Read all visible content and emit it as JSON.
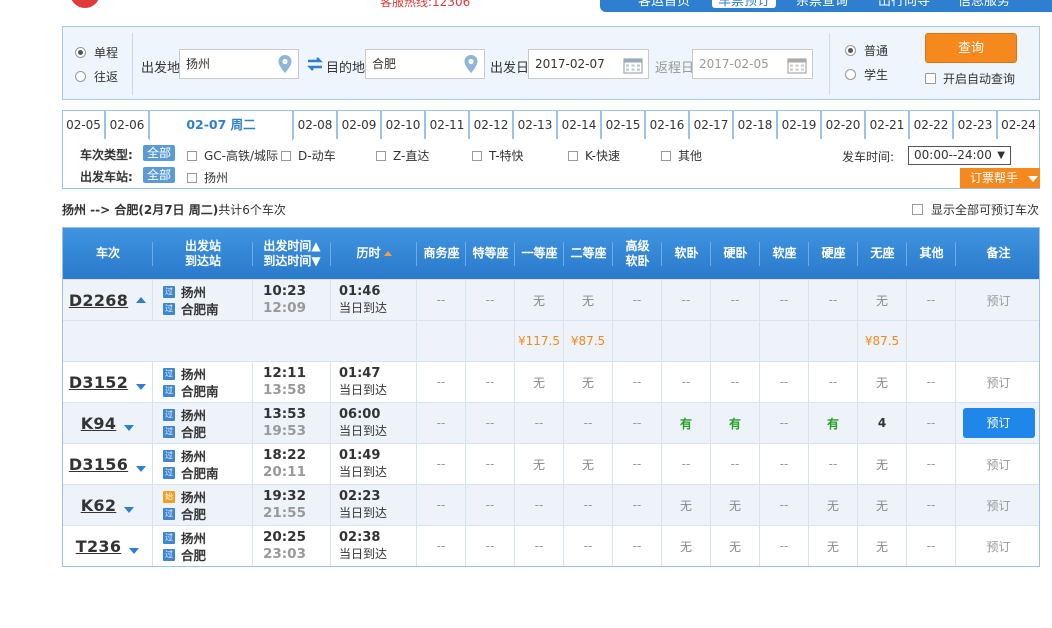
{
  "topbar": {
    "hotline": "客服热线:12306",
    "nav": [
      "客运首页",
      "车票预订",
      "余票查询",
      "出行向导",
      "信息服务"
    ],
    "active_nav": 1
  },
  "search": {
    "trip_types": [
      "单程",
      "往返"
    ],
    "trip_selected": 0,
    "from_label": "出发地",
    "from_value": "扬州",
    "to_label": "目的地",
    "to_value": "合肥",
    "depart_label": "出发日",
    "depart_value": "2017-02-07",
    "return_label": "返程日",
    "return_value": "2017-02-05",
    "ticket_types": [
      "普通",
      "学生"
    ],
    "ticket_selected": 0,
    "query_label": "查询",
    "auto_query_label": "开启自动查询"
  },
  "dates": {
    "before": [
      "02-05",
      "02-06"
    ],
    "active": "02-07 周二",
    "after": [
      "02-08",
      "02-09",
      "02-10",
      "02-11",
      "02-12",
      "02-13",
      "02-14",
      "02-15",
      "02-16",
      "02-17",
      "02-18",
      "02-19",
      "02-20",
      "02-21",
      "02-22",
      "02-23",
      "02-24"
    ]
  },
  "filters": {
    "type_label": "车次类型:",
    "all_label": "全部",
    "types": [
      "GC-高铁/城际",
      "D-动车",
      "Z-直达",
      "T-特快",
      "K-快速",
      "其他"
    ],
    "station_label": "出发车站:",
    "stations": [
      "扬州"
    ],
    "time_label": "发车时间:",
    "time_value": "00:00--24:00",
    "help_label": "订票帮手"
  },
  "summary": {
    "route": "扬州 --> 合肥(2月7日 周二)",
    "count": "共计6个车次",
    "show_all": "显示全部可预订车次"
  },
  "table": {
    "headers": {
      "train": "车次",
      "station_1": "出发站",
      "station_2": "到达站",
      "time_1": "出发时间▲",
      "time_2": "到达时间▼",
      "duration": "历时",
      "business": "商务座",
      "premium": "特等座",
      "first": "一等座",
      "second": "二等座",
      "high_sleeper_1": "高级",
      "high_sleeper_2": "软卧",
      "soft_sleeper": "软卧",
      "hard_sleeper": "硬卧",
      "soft_seat": "软座",
      "hard_seat": "硬座",
      "no_seat": "无座",
      "other": "其他",
      "remark": "备注"
    },
    "badge_pass": "过",
    "badge_start": "始",
    "rows": [
      {
        "no": "D2268",
        "from": "扬州",
        "to": "合肥南",
        "start_badge": "过",
        "dep": "10:23",
        "arr": "12:09",
        "dur": "01:46",
        "day": "当日到达",
        "c": [
          "--",
          "--",
          "无",
          "无",
          "--",
          "--",
          "--",
          "--",
          "--",
          "无",
          "--"
        ],
        "book": "预订"
      },
      {
        "no": "D3152",
        "from": "扬州",
        "to": "合肥南",
        "start_badge": "过",
        "dep": "12:11",
        "arr": "13:58",
        "dur": "01:47",
        "day": "当日到达",
        "c": [
          "--",
          "--",
          "无",
          "无",
          "--",
          "--",
          "--",
          "--",
          "--",
          "无",
          "--"
        ],
        "book": "预订"
      },
      {
        "no": "K94",
        "from": "扬州",
        "to": "合肥",
        "start_badge": "过",
        "dep": "13:53",
        "arr": "19:53",
        "dur": "06:00",
        "day": "当日到达",
        "c": [
          "--",
          "--",
          "--",
          "--",
          "--",
          "有",
          "有",
          "--",
          "有",
          "4",
          "--"
        ],
        "book": "预订"
      },
      {
        "no": "D3156",
        "from": "扬州",
        "to": "合肥南",
        "start_badge": "过",
        "dep": "18:22",
        "arr": "20:11",
        "dur": "01:49",
        "day": "当日到达",
        "c": [
          "--",
          "--",
          "无",
          "无",
          "--",
          "--",
          "--",
          "--",
          "--",
          "无",
          "--"
        ],
        "book": "预订"
      },
      {
        "no": "K62",
        "from": "扬州",
        "to": "合肥",
        "start_badge": "始",
        "dep": "19:32",
        "arr": "21:55",
        "dur": "02:23",
        "day": "当日到达",
        "c": [
          "--",
          "--",
          "--",
          "--",
          "--",
          "无",
          "无",
          "--",
          "无",
          "无",
          "--"
        ],
        "book": "预订"
      },
      {
        "no": "T236",
        "from": "扬州",
        "to": "合肥",
        "start_badge": "过",
        "dep": "20:25",
        "arr": "23:03",
        "dur": "02:38",
        "day": "当日到达",
        "c": [
          "--",
          "--",
          "--",
          "--",
          "--",
          "无",
          "无",
          "--",
          "无",
          "无",
          "--"
        ],
        "book": "预订"
      }
    ],
    "price_row": {
      "first": "¥117.5",
      "second": "¥87.5",
      "no_seat": "¥87.5"
    }
  },
  "colors": {
    "accent": "#2f7fd0",
    "orange": "#f5891e",
    "green": "#28a028"
  }
}
